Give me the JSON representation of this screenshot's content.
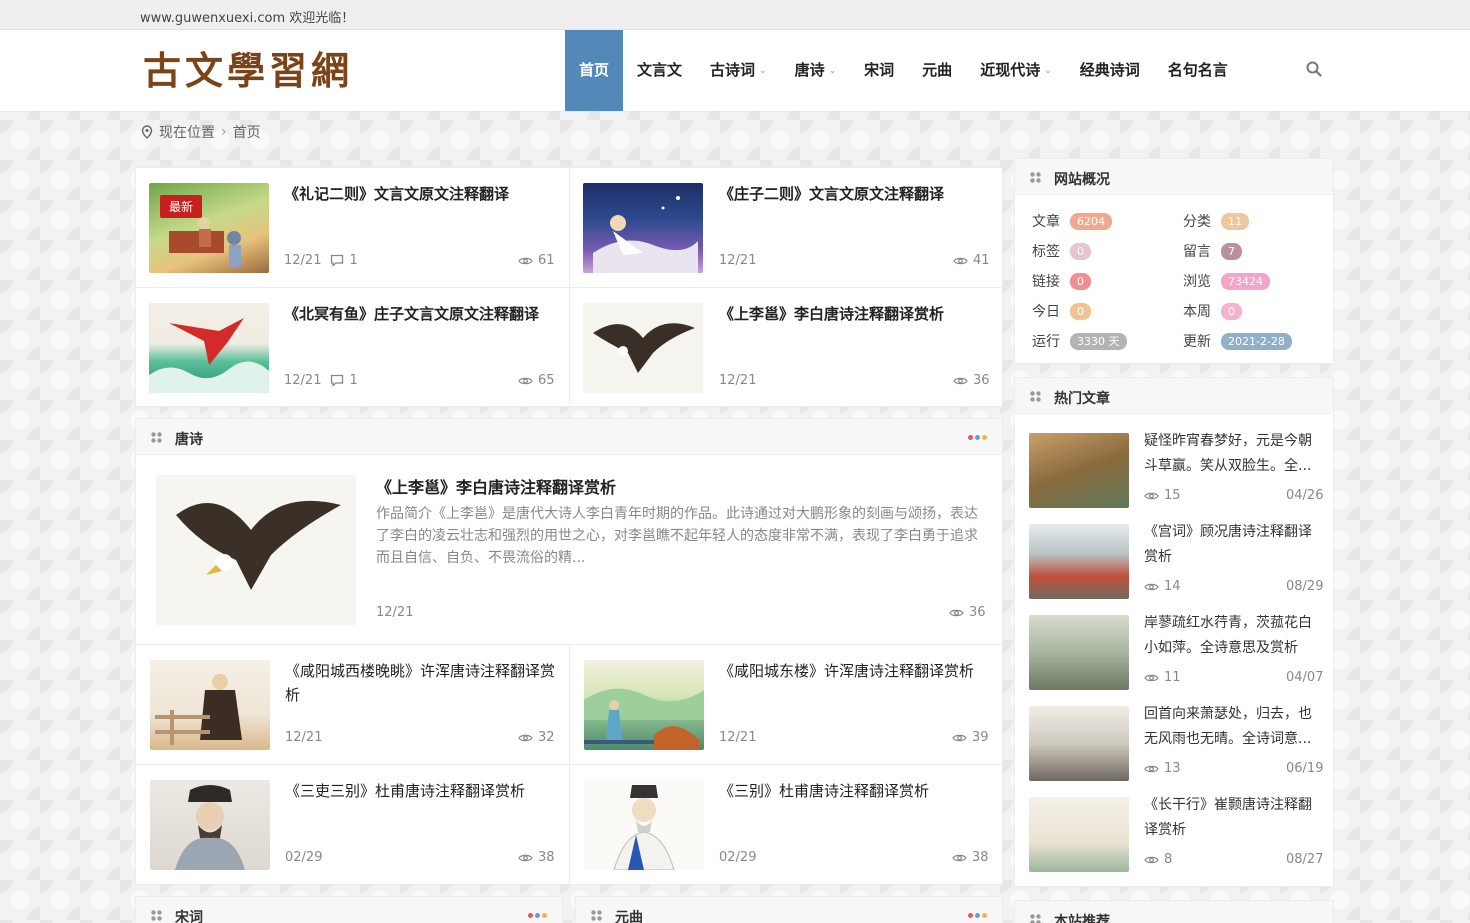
{
  "topbar": {
    "welcome": "www.guwenxuexi.com 欢迎光临！"
  },
  "logo": {
    "text": "古文學習網"
  },
  "nav": {
    "items": [
      {
        "label": "首页",
        "active": true,
        "has_sub": false
      },
      {
        "label": "文言文",
        "active": false,
        "has_sub": false
      },
      {
        "label": "古诗词",
        "active": false,
        "has_sub": true
      },
      {
        "label": "唐诗",
        "active": false,
        "has_sub": true
      },
      {
        "label": "宋词",
        "active": false,
        "has_sub": false
      },
      {
        "label": "元曲",
        "active": false,
        "has_sub": false
      },
      {
        "label": "近现代诗",
        "active": false,
        "has_sub": true
      },
      {
        "label": "经典诗词",
        "active": false,
        "has_sub": false
      },
      {
        "label": "名句名言",
        "active": false,
        "has_sub": false
      }
    ]
  },
  "breadcrumb": {
    "location": "现在位置",
    "current": "首页"
  },
  "latest": {
    "badge": "最新",
    "items": [
      {
        "title": "《礼记二则》文言文原文注释翻译",
        "date": "12/21",
        "comments": "1",
        "views": "61"
      },
      {
        "title": "《庄子二则》文言文原文注释翻译",
        "date": "12/21",
        "comments": "",
        "views": "41"
      },
      {
        "title": "《北冥有鱼》庄子文言文原文注释翻译",
        "date": "12/21",
        "comments": "1",
        "views": "65"
      },
      {
        "title": "《上李邕》李白唐诗注释翻译赏析",
        "date": "12/21",
        "comments": "",
        "views": "36"
      }
    ]
  },
  "tangshi": {
    "title": "唐诗",
    "featured": {
      "title": "《上李邕》李白唐诗注释翻译赏析",
      "excerpt": "作品简介《上李邕》是唐代大诗人李白青年时期的作品。此诗通过对大鹏形象的刻画与颂扬，表达了李白的凌云壮志和强烈的用世之心，对李邕瞧不起年轻人的态度非常不满，表现了李白勇于追求而且自信、自负、不畏流俗的精...",
      "date": "12/21",
      "views": "36"
    },
    "items": [
      {
        "title": "《咸阳城西楼晚眺》许浑唐诗注释翻译赏析",
        "date": "12/21",
        "views": "32"
      },
      {
        "title": "《咸阳城东楼》许浑唐诗注释翻译赏析",
        "date": "12/21",
        "views": "39"
      },
      {
        "title": "《三吏三别》杜甫唐诗注释翻译赏析",
        "date": "02/29",
        "views": "38"
      },
      {
        "title": "《三别》杜甫唐诗注释翻译赏析",
        "date": "02/29",
        "views": "38"
      }
    ]
  },
  "songci": {
    "title": "宋词"
  },
  "yuanqu": {
    "title": "元曲"
  },
  "overview": {
    "title": "网站概况",
    "stats": [
      {
        "label": "文章",
        "value": "6204",
        "color": "#f0a98c"
      },
      {
        "label": "分类",
        "value": "11",
        "color": "#f2c69c"
      },
      {
        "label": "标签",
        "value": "0",
        "color": "#e8c4cc"
      },
      {
        "label": "留言",
        "value": "7",
        "color": "#b9909c"
      },
      {
        "label": "链接",
        "value": "0",
        "color": "#f08f8f"
      },
      {
        "label": "浏览",
        "value": "73424",
        "color": "#f2a5c8"
      },
      {
        "label": "今日",
        "value": "0",
        "color": "#f2c290"
      },
      {
        "label": "本周",
        "value": "0",
        "color": "#f4b3cb"
      },
      {
        "label": "运行",
        "value": "3330 天",
        "color": "#b3b3b3"
      },
      {
        "label": "更新",
        "value": "2021-2-28",
        "color": "#8fb0c8"
      }
    ]
  },
  "hot": {
    "title": "热门文章",
    "items": [
      {
        "title": "疑怪昨宵春梦好，元是今朝斗草赢。笑从双脸生。全...",
        "views": "15",
        "date": "04/26"
      },
      {
        "title": "《宫词》顾况唐诗注释翻译赏析",
        "views": "14",
        "date": "08/29"
      },
      {
        "title": "岸蓼疏红水荇青，茨菰花白小如萍。全诗意思及赏析",
        "views": "11",
        "date": "04/07"
      },
      {
        "title": "回首向来萧瑟处，归去，也无风雨也无晴。全诗词意...",
        "views": "13",
        "date": "06/19"
      },
      {
        "title": "《长干行》崔颢唐诗注释翻译赏析",
        "views": "8",
        "date": "08/27"
      }
    ]
  },
  "recommend": {
    "title": "本站推荐"
  },
  "colors": {
    "accent": "#5389b8",
    "badge": "#c81f1f"
  }
}
